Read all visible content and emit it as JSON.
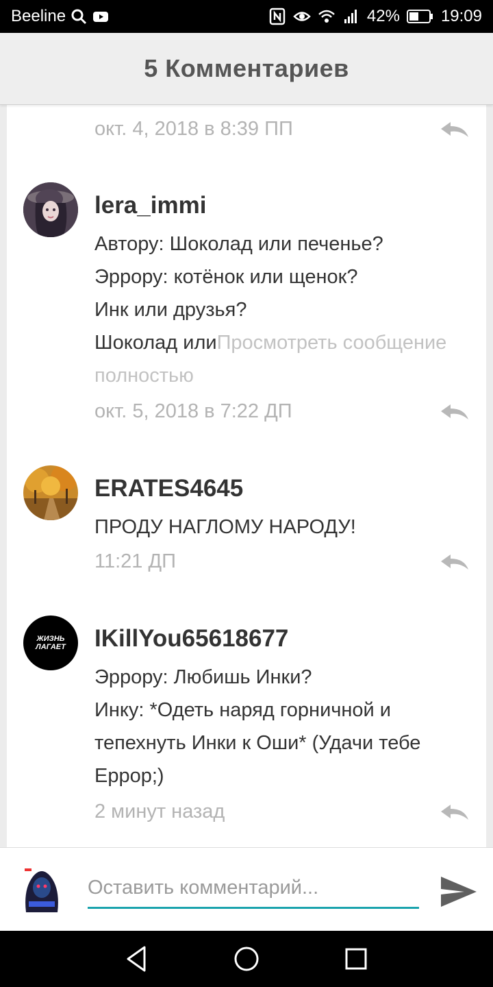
{
  "status_bar": {
    "carrier": "Beeline",
    "battery": "42%",
    "time": "19:09"
  },
  "header": {
    "title": "5 Комментариев"
  },
  "comments": [
    {
      "author": "",
      "text": "",
      "time": "окт. 4, 2018 в 8:39 ПП"
    },
    {
      "author": "lera_immi",
      "lines": [
        "Автору: Шоколад или печенье?",
        "Эррору: котёнок или щенок?",
        "Инк или друзья?",
        "Шоколад или"
      ],
      "more": "Просмотреть сообщение полностью",
      "time": "окт. 5, 2018 в 7:22 ДП"
    },
    {
      "author": "ERATES4645",
      "text": "ПРОДУ НАГЛОМУ НАРОДУ!",
      "time": "11:21 ДП"
    },
    {
      "author": "IKillYou65618677",
      "avatar_text": "ЖИЗНЬ ЛАГАЕТ",
      "lines": [
        "Эррору: Любишь Инки?",
        "Инку: *Одеть наряд горничной и тепехнуть Инки к Оши* (Удачи тебе Еррор;)"
      ],
      "time": "2 минут назад"
    }
  ],
  "composer": {
    "placeholder": "Оставить комментарий..."
  },
  "colors": {
    "accent": "#1aa3ad",
    "meta_text": "#b3b3b3",
    "header_bg": "#eeeeee"
  },
  "icons": [
    "search-icon",
    "youtube-icon",
    "nfc-icon",
    "eye-icon",
    "wifi-icon",
    "signal-icon",
    "battery-icon",
    "reply-icon",
    "send-icon",
    "back-icon",
    "home-icon",
    "recents-icon"
  ]
}
